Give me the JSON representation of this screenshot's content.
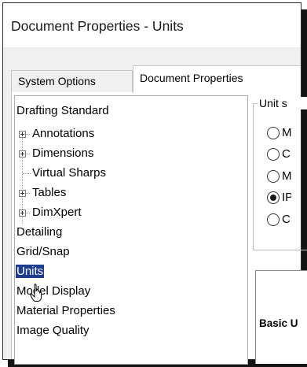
{
  "window": {
    "title": "Document Properties - Units"
  },
  "tabs": [
    {
      "label": "System Options",
      "active": false
    },
    {
      "label": "Document Properties",
      "active": true
    }
  ],
  "tree": {
    "items": [
      {
        "label": "Drafting Standard",
        "level": 0,
        "expandable": false
      },
      {
        "label": "Annotations",
        "level": 1,
        "expandable": true
      },
      {
        "label": "Dimensions",
        "level": 1,
        "expandable": true
      },
      {
        "label": "Virtual Sharps",
        "level": 1,
        "expandable": false
      },
      {
        "label": "Tables",
        "level": 1,
        "expandable": true
      },
      {
        "label": "DimXpert",
        "level": 1,
        "expandable": true
      },
      {
        "label": "Detailing",
        "level": 0,
        "expandable": false
      },
      {
        "label": "Grid/Snap",
        "level": 0,
        "expandable": false
      },
      {
        "label": "Units",
        "level": 0,
        "expandable": false,
        "selected": true
      },
      {
        "label": "Model Display",
        "level": 0,
        "expandable": false
      },
      {
        "label": "Material Properties",
        "level": 0,
        "expandable": false
      },
      {
        "label": "Image Quality",
        "level": 0,
        "expandable": false
      }
    ]
  },
  "unit_system": {
    "label": "Unit s",
    "options": [
      {
        "label": "M",
        "checked": false
      },
      {
        "label": "C",
        "checked": false
      },
      {
        "label": "M",
        "checked": false
      },
      {
        "label": "IP",
        "checked": true
      },
      {
        "label": "C",
        "checked": false
      }
    ]
  },
  "units_table": {
    "header": "Basic U"
  },
  "colors": {
    "selection": "#1e3d8f",
    "shadow": "#141414"
  },
  "cursor": {
    "icon": "hand-pointer-icon"
  }
}
